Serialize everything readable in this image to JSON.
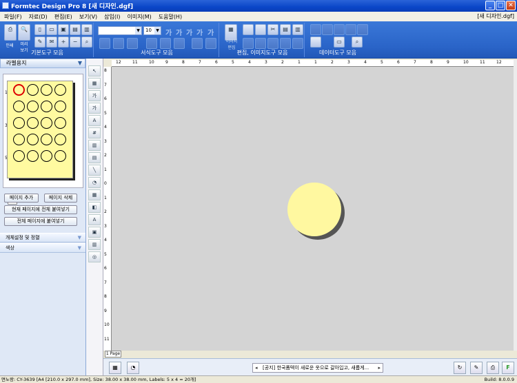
{
  "window": {
    "title": "Formtec Design Pro 8 [새 디자인.dgf]",
    "doc_name_right": "[새 디자인.dgf]",
    "controls": [
      "_",
      "□",
      "✕"
    ]
  },
  "menu": [
    "파일(F)",
    "자료(D)",
    "편집(E)",
    "보기(V)",
    "삽입(I)",
    "이미지(M)",
    "도움말(H)"
  ],
  "ribbon": {
    "groups": [
      "기본도구 모음",
      "서식도구 모음",
      "편집, 이미지도구 모음",
      "데이터도구 모음"
    ],
    "print_label": "인쇄",
    "preview_label": "미리\n보기",
    "image_edit_label": "이미지\n편집",
    "font_size": "10",
    "font_buttons": [
      "가",
      "가",
      "가",
      "가",
      "가"
    ]
  },
  "left_panel": {
    "header": "라벨용지",
    "row_numbers": [
      "1",
      "3",
      "5"
    ],
    "page_tab": "1P",
    "buttons": [
      "페이지 추가",
      "페이지 삭제",
      "현재 페이지에 전체 붙여넣기",
      "전체 페이지에 붙여넣기"
    ],
    "sections": [
      "개체설정 및 정렬",
      "색상"
    ],
    "labels_per_row": 4,
    "label_rows": 5
  },
  "ruler": {
    "top": [
      "12",
      "11",
      "10",
      "9",
      "8",
      "7",
      "6",
      "5",
      "4",
      "3",
      "2",
      "1",
      "1",
      "2",
      "3",
      "4",
      "5",
      "6",
      "7",
      "8",
      "9",
      "10",
      "11",
      "12"
    ],
    "left": [
      "8",
      "7",
      "6",
      "5",
      "4",
      "3",
      "2",
      "1",
      "0",
      "1",
      "2",
      "3",
      "4",
      "5",
      "6",
      "7",
      "8",
      "9",
      "10",
      "11"
    ]
  },
  "page_tab": "1 Page",
  "notice": "[공지] 한국폼텍이 새로운 옷으로 갈아입고, 새롭게...",
  "status": {
    "text": "면노랑: CY-3639 [A4 [210.0 x 297.0 mm], Size: 38.00 x 38.00 mm, Labels: 5 x 4 = 20개]",
    "build": "Build: 8.0.0.9"
  },
  "colors": {
    "ribbon": "#2a64c8",
    "label_fill": "#fffaa0",
    "canvas": "#d4d4d4",
    "selected_label_border": "#dd0000"
  }
}
